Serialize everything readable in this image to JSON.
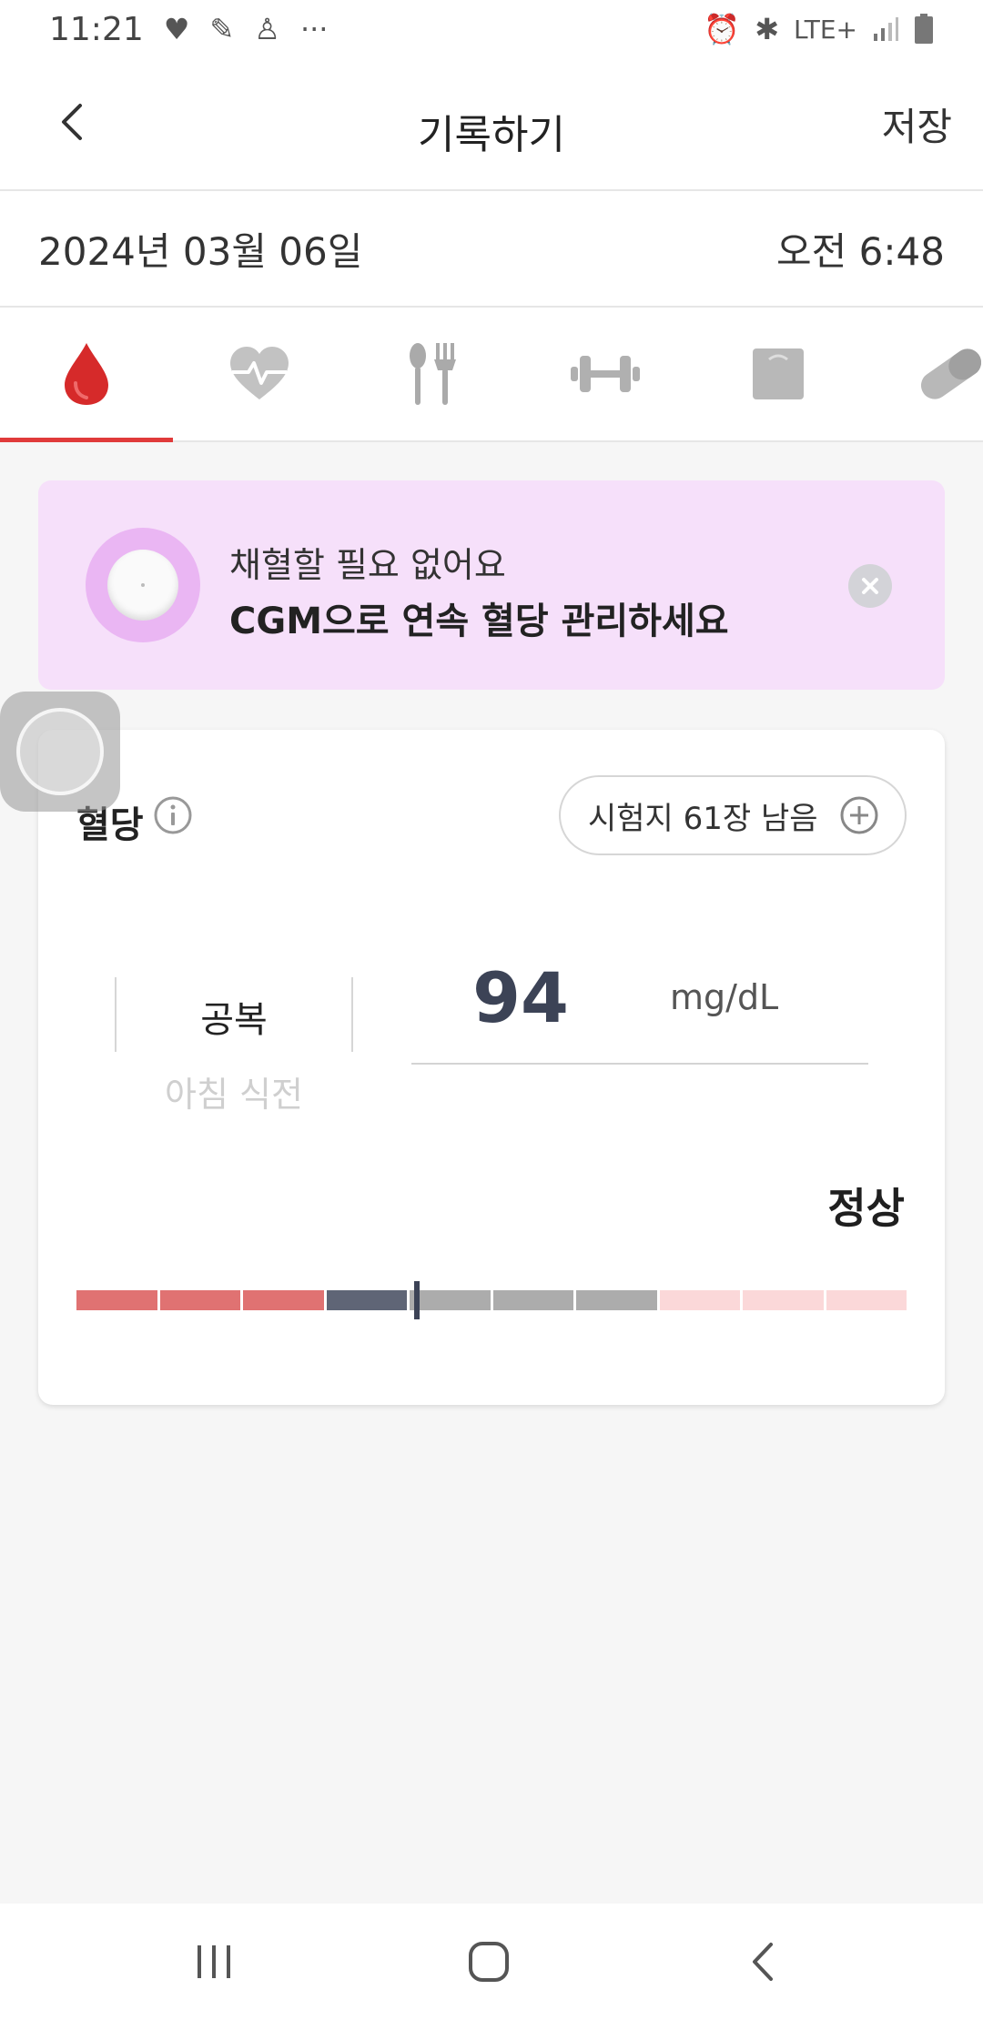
{
  "status_bar": {
    "time": "11:21",
    "left_icons": [
      "heart-health-icon",
      "shoe-icon",
      "fitness-icon",
      "more-dots-icon"
    ],
    "more": "···",
    "network": "LTE+",
    "right_icons": [
      "alarm-icon",
      "bluetooth-icon",
      "lte-icon",
      "signal-icon",
      "battery-icon"
    ]
  },
  "app_bar": {
    "title": "기록하기",
    "save_label": "저장",
    "back_icon": "chevron-left-icon"
  },
  "date_row": {
    "date": "2024년 03월 06일",
    "time": "오전 6:48"
  },
  "tabs": [
    {
      "icon": "blood-drop-icon",
      "active": true
    },
    {
      "icon": "heart-rate-icon",
      "active": false
    },
    {
      "icon": "meal-icon",
      "active": false
    },
    {
      "icon": "dumbbell-icon",
      "active": false
    },
    {
      "icon": "scale-icon",
      "active": false
    },
    {
      "icon": "pill-icon",
      "active": false
    }
  ],
  "banner": {
    "line1": "채혈할 필요 없어요",
    "line2": "CGM으로 연속 혈당 관리하세요",
    "close_icon": "close-circle-icon",
    "background": "#f6e0fa"
  },
  "card": {
    "title": "혈당",
    "strips_label": "시험지 61장 남음",
    "meal_primary": "공복",
    "meal_secondary": "아침 식전",
    "glucose_value": "94",
    "glucose_unit": "mg/dL",
    "status": "정상",
    "range": {
      "segments": 10,
      "colors": [
        "#e07272",
        "#e07272",
        "#e07272",
        "#5f6576",
        "#acacac",
        "#acacac",
        "#acacac",
        "#fbd8d9",
        "#fbd8d9",
        "#fbd8d9"
      ],
      "marker_fraction": 0.41
    }
  },
  "accent_color": "#e03a3a",
  "nav_bar": {
    "icons": [
      "recent-apps-icon",
      "home-icon",
      "back-icon"
    ]
  }
}
